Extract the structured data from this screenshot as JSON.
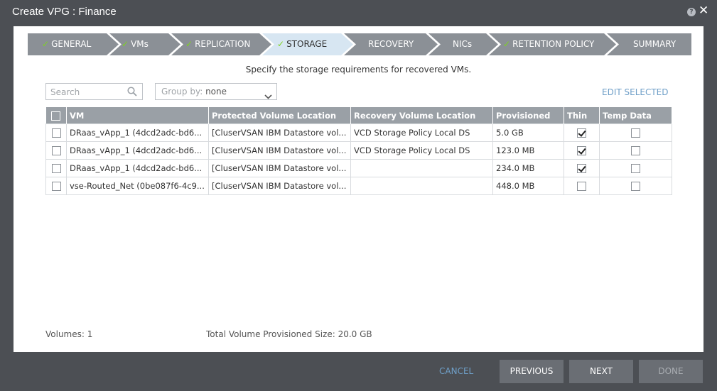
{
  "window": {
    "title": "Create VPG : Finance",
    "help_glyph": "?",
    "close_glyph": "✕"
  },
  "wizard": {
    "steps": [
      {
        "label": "GENERAL",
        "done": true
      },
      {
        "label": "VMs",
        "done": true
      },
      {
        "label": "REPLICATION",
        "done": true
      },
      {
        "label": "STORAGE",
        "done": true,
        "active": true
      },
      {
        "label": "RECOVERY",
        "done": false
      },
      {
        "label": "NICs",
        "done": false
      },
      {
        "label": "RETENTION POLICY",
        "done": true
      },
      {
        "label": "SUMMARY",
        "done": false
      }
    ],
    "check_glyph": "✓"
  },
  "subtitle": "Specify the storage requirements for recovered VMs.",
  "search": {
    "placeholder": "Search"
  },
  "group_by": {
    "label": "Group by:",
    "value": "none"
  },
  "edit_selected": "EDIT SELECTED",
  "table": {
    "headers": [
      "VM",
      "Protected Volume Location",
      "Recovery Volume Location",
      "Provisioned",
      "Thin",
      "Temp Data"
    ],
    "rows": [
      {
        "vm": "DRaas_vApp_1 (4dcd2adc-bd6...",
        "protected": "[CluserVSAN IBM Datastore vol...",
        "recovery": "VCD Storage Policy Local DS",
        "provisioned": "5.0 GB",
        "thin": true,
        "temp": false
      },
      {
        "vm": "DRaas_vApp_1 (4dcd2adc-bd6...",
        "protected": "[CluserVSAN IBM Datastore vol...",
        "recovery": "VCD Storage Policy Local DS",
        "provisioned": "123.0 MB",
        "thin": true,
        "temp": false
      },
      {
        "vm": "DRaas_vApp_1 (4dcd2adc-bd6...",
        "protected": "[CluserVSAN IBM Datastore vol...",
        "recovery": "",
        "provisioned": "234.0 MB",
        "thin": true,
        "temp": false
      },
      {
        "vm": "vse-Routed_Net (0be087f6-4c9...",
        "protected": "[CluserVSAN IBM Datastore vol...",
        "recovery": "",
        "provisioned": "448.0 MB",
        "thin": false,
        "temp": false
      }
    ]
  },
  "footer": {
    "volumes": "Volumes: 1",
    "total": "Total Volume Provisioned Size: 20.0 GB"
  },
  "buttons": {
    "cancel": "CANCEL",
    "previous": "PREVIOUS",
    "next": "NEXT",
    "done": "DONE"
  },
  "colors": {
    "step_inactive": "#8b9096",
    "step_active": "#d7e6f2",
    "check": "#7ed321",
    "link": "#6f9fc8",
    "button": "#6a6e74"
  },
  "icons": {
    "search": "search-icon",
    "dropdown": "chevron-down-icon",
    "help": "help-icon",
    "close": "close-icon",
    "step_check": "checkmark-icon"
  }
}
